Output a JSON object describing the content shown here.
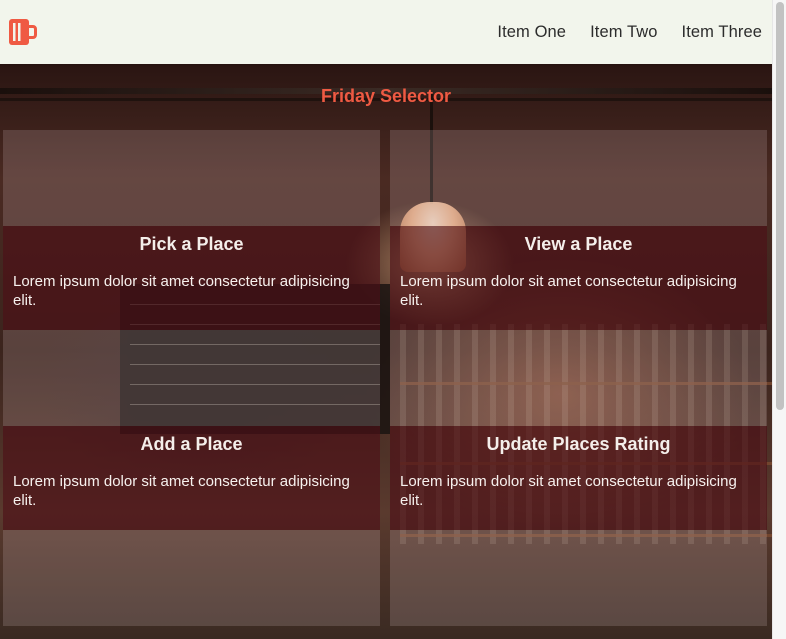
{
  "nav": {
    "logo": "mug-logo-icon",
    "items": [
      "Item One",
      "Item Two",
      "Item Three"
    ]
  },
  "page": {
    "title": "Friday Selector"
  },
  "cards": [
    {
      "title": "Pick a Place",
      "text": "Lorem ipsum dolor sit amet consectetur adipisicing elit."
    },
    {
      "title": "View a Place",
      "text": "Lorem ipsum dolor sit amet consectetur adipisicing elit."
    },
    {
      "title": "Add a Place",
      "text": "Lorem ipsum dolor sit amet consectetur adipisicing elit."
    },
    {
      "title": "Update Places Rating",
      "text": "Lorem ipsum dolor sit amet consectetur adipisicing elit."
    }
  ],
  "colors": {
    "accent": "#ef5a43",
    "navbar_bg": "#f2f5ec"
  }
}
